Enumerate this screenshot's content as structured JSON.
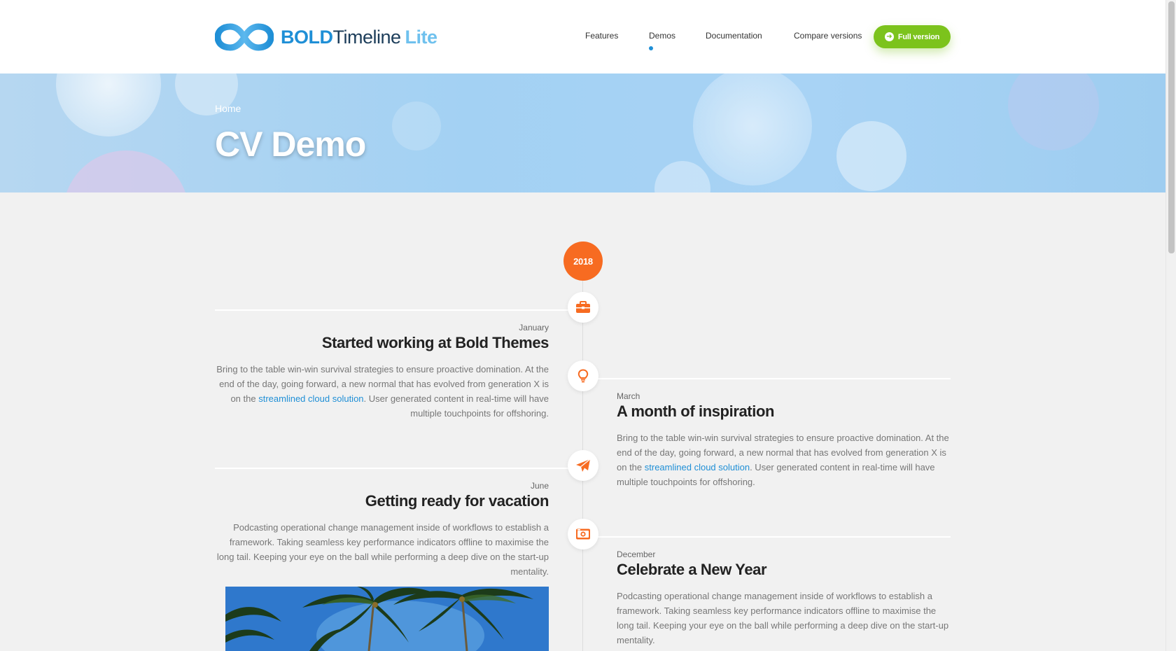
{
  "header": {
    "logo_icon": "infinity-logo-icon",
    "logo_bold": "BOLD",
    "logo_mid": "Timeline",
    "logo_lite": "Lite",
    "nav": [
      {
        "label": "Features",
        "active": false
      },
      {
        "label": "Demos",
        "active": true
      },
      {
        "label": "Documentation",
        "active": false
      },
      {
        "label": "Compare versions",
        "active": false
      }
    ],
    "cta_label": "Full version",
    "cta_icon": "arrow-right-icon"
  },
  "hero": {
    "breadcrumb": "Home",
    "title": "CV Demo"
  },
  "timeline": {
    "year": "2018",
    "entries": [
      {
        "side": "left",
        "icon": "briefcase-icon",
        "date": "January",
        "title": "Started working at Bold Themes",
        "body_before": "Bring to the table win-win survival strategies to ensure proactive domination. At the end of the day, going forward, a new normal that has evolved from generation X is on the ",
        "link": "streamlined cloud solution",
        "body_after": ". User generated content in real-time will have multiple touchpoints for offshoring."
      },
      {
        "side": "right",
        "icon": "lightbulb-icon",
        "date": "March",
        "title": "A month of inspiration",
        "body_before": "Bring to the table win-win survival strategies to ensure proactive domination. At the end of the day, going forward, a new normal that has evolved from generation X is on the ",
        "link": "streamlined cloud solution",
        "body_after": ". User generated content in real-time will have multiple touchpoints for offshoring."
      },
      {
        "side": "left",
        "icon": "paper-plane-icon",
        "date": "June",
        "title": "Getting ready for vacation",
        "body": "Podcasting operational change management inside of workflows to establish a framework. Taking seamless key performance indicators offline to maximise the long tail. Keeping your eye on the ball while performing a deep dive on the start-up mentality.",
        "image": "palm-trees-photo"
      },
      {
        "side": "right",
        "icon": "camera-icon",
        "date": "December",
        "title": "Celebrate a New Year",
        "body": "Podcasting operational change management inside of workflows to establish a framework. Taking seamless key performance indicators offline to maximise the long tail. Keeping your eye on the ball while performing a deep dive on the start-up mentality."
      }
    ]
  },
  "colors": {
    "brand_blue": "#1f8fd6",
    "cta_green": "#7cc31c",
    "accent_orange": "#f76b21",
    "page_bg": "#f1f1f1"
  }
}
